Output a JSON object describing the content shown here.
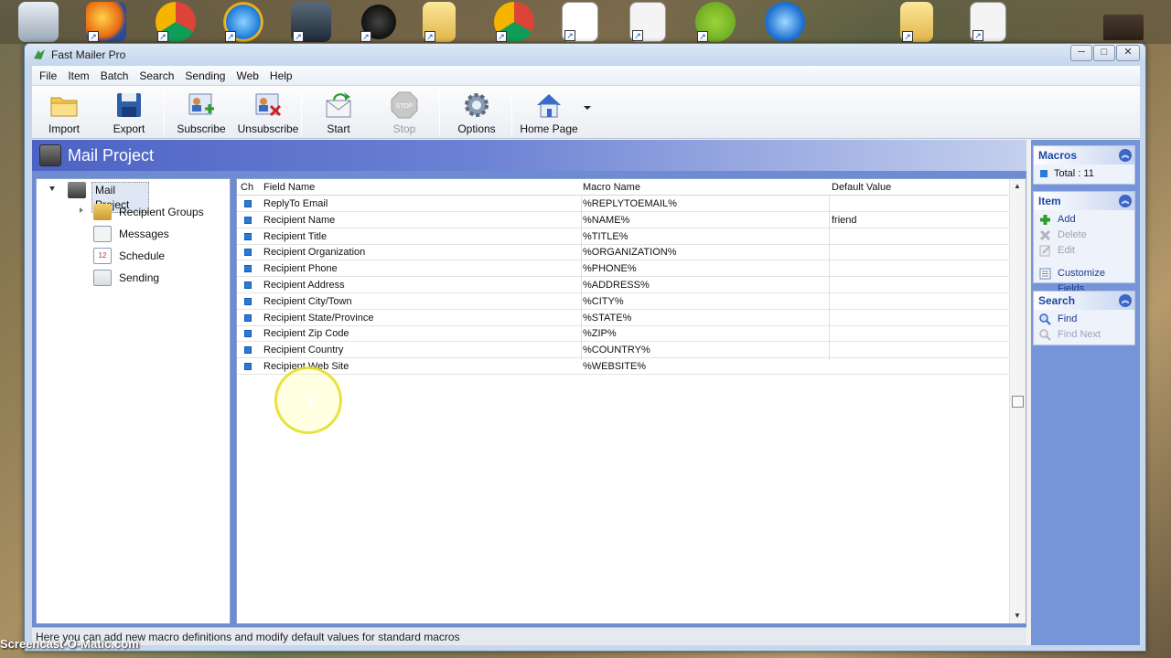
{
  "desktop": {
    "icons": [
      "recycle-bin-icon",
      "firefox-icon",
      "chrome-icon",
      "internet-explorer-icon",
      "camtasia-icon",
      "speaker-icon",
      "folder-icon",
      "chrome-icon",
      "pdf-document-icon",
      "excel-document-icon",
      "joinme-icon",
      "itunes-icon",
      "folder-icon",
      "excel-document-icon"
    ],
    "watermark": "Screencast-O-Matic.com"
  },
  "window": {
    "title": "Fast Mailer Pro",
    "controls": {
      "minimize": "─",
      "maximize": "□",
      "close": "✕"
    }
  },
  "menu": [
    "File",
    "Item",
    "Batch",
    "Search",
    "Sending",
    "Web",
    "Help"
  ],
  "toolbar": {
    "buttons": [
      {
        "label": "Import",
        "icon": "folder-icon",
        "enabled": true
      },
      {
        "label": "Export",
        "icon": "save-disk-icon",
        "enabled": true
      },
      {
        "label": "Subscribe",
        "icon": "add-user-card-icon",
        "enabled": true
      },
      {
        "label": "Unsubscribe",
        "icon": "remove-user-card-icon",
        "enabled": true
      },
      {
        "label": "Start",
        "icon": "send-envelope-icon",
        "enabled": true
      },
      {
        "label": "Stop",
        "icon": "stop-sign-icon",
        "enabled": false
      },
      {
        "label": "Options",
        "icon": "gear-icon",
        "enabled": true
      },
      {
        "label": "Home Page",
        "icon": "home-icon",
        "enabled": true
      }
    ],
    "stop_sign_text": "STOP"
  },
  "header": {
    "title": "Mail Project"
  },
  "tree": {
    "root": "Mail Project",
    "children": [
      "Recipient Groups",
      "Messages",
      "Schedule",
      "Sending"
    ],
    "schedule_icon_number": "12"
  },
  "grid": {
    "columns": [
      "Ch",
      "Field Name",
      "Macro Name",
      "Default Value"
    ],
    "rows": [
      {
        "field": "ReplyTo Email",
        "macro": "%REPLYTOEMAIL%",
        "default": ""
      },
      {
        "field": "Recipient Name",
        "macro": "%NAME%",
        "default": "friend"
      },
      {
        "field": "Recipient Title",
        "macro": "%TITLE%",
        "default": ""
      },
      {
        "field": "Recipient Organization",
        "macro": "%ORGANIZATION%",
        "default": ""
      },
      {
        "field": "Recipient Phone",
        "macro": "%PHONE%",
        "default": ""
      },
      {
        "field": "Recipient Address",
        "macro": "%ADDRESS%",
        "default": ""
      },
      {
        "field": "Recipient City/Town",
        "macro": "%CITY%",
        "default": ""
      },
      {
        "field": "Recipient State/Province",
        "macro": "%STATE%",
        "default": ""
      },
      {
        "field": "Recipient Zip Code",
        "macro": "%ZIP%",
        "default": ""
      },
      {
        "field": "Recipient Country",
        "macro": "%COUNTRY%",
        "default": ""
      },
      {
        "field": "Recipient Web Site",
        "macro": "%WEBSITE%",
        "default": ""
      }
    ]
  },
  "taskpane": {
    "macros": {
      "title": "Macros",
      "items": [
        {
          "label": "Total : 11",
          "enabled": true
        }
      ]
    },
    "item": {
      "title": "Item",
      "items": [
        {
          "label": "Add",
          "enabled": true,
          "icon": "plus-icon"
        },
        {
          "label": "Delete",
          "enabled": false,
          "icon": "delete-x-icon"
        },
        {
          "label": "Edit",
          "enabled": false,
          "icon": "edit-icon"
        },
        {
          "label": "Customize Fields",
          "enabled": true,
          "icon": "list-icon"
        }
      ]
    },
    "search": {
      "title": "Search",
      "items": [
        {
          "label": "Find",
          "enabled": true,
          "icon": "magnifier-icon"
        },
        {
          "label": "Find Next",
          "enabled": false,
          "icon": "magnifier-next-icon"
        }
      ]
    }
  },
  "status": "Here you can add new macro definitions and modify default values for standard macros",
  "colors": {
    "header_band": "#4d63c4",
    "taskpane_bg": "#7694d8",
    "link": "#1a3c8c",
    "check": "#2a7ad8"
  }
}
